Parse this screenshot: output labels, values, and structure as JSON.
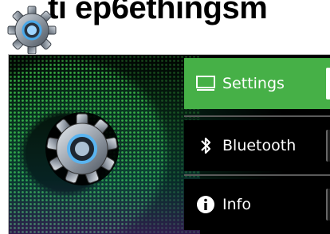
{
  "header": {
    "title": "ti ep6ethingsm",
    "icon": "gear-icon"
  },
  "menu": {
    "items": [
      {
        "label": "Settings",
        "icon": "monitor-icon",
        "selected": true
      },
      {
        "label": "Bluetooth",
        "icon": "bluetooth-icon",
        "selected": false
      },
      {
        "label": "Info",
        "icon": "info-icon",
        "selected": false
      }
    ]
  },
  "colors": {
    "accent": "#46b047",
    "background": "#000000",
    "text": "#ffffff"
  }
}
